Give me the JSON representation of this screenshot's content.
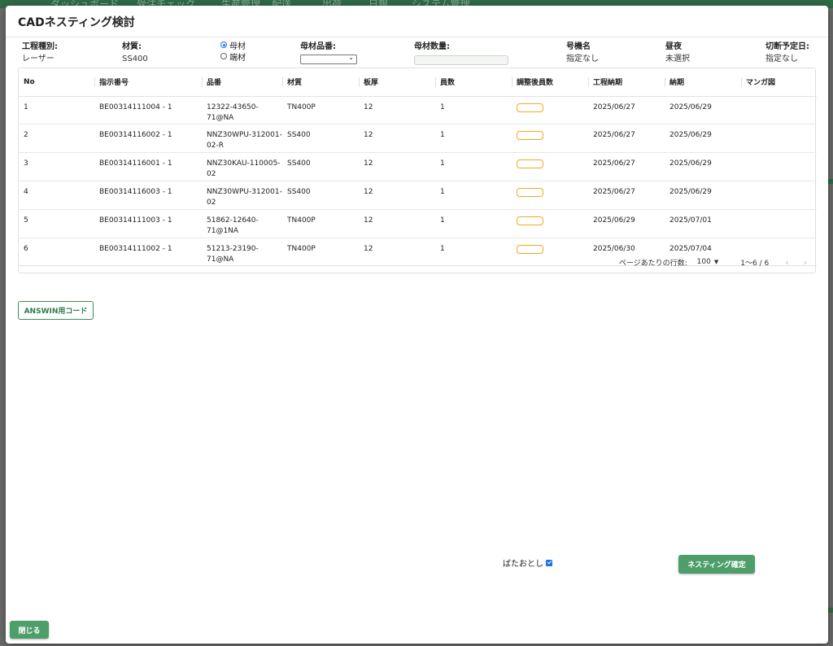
{
  "modal": {
    "title": "CADネスティング検討"
  },
  "header_fields": {
    "process_type": {
      "label": "工程種別:",
      "value": "レーザー"
    },
    "material": {
      "label": "材質:",
      "value": "SS400"
    },
    "source_options": [
      {
        "label": "母材",
        "checked": true
      },
      {
        "label": "端材",
        "checked": false
      }
    ],
    "base_material_part": {
      "label": "母材品番:",
      "selected": ""
    },
    "base_material_qty": {
      "label": "母材数量:",
      "value": ""
    },
    "machine_name": {
      "label": "号機名",
      "value": "指定なし"
    },
    "day_night": {
      "label": "昼夜",
      "value": "未選択"
    },
    "cut_date": {
      "label": "切断予定日:",
      "value": "指定なし"
    }
  },
  "table": {
    "columns": [
      "No",
      "指示番号",
      "品番",
      "材質",
      "板厚",
      "員数",
      "調整後員数",
      "工程納期",
      "納期",
      "マンガ図"
    ],
    "rows": [
      {
        "no": "1",
        "instr": "BE00314111004 - 1",
        "part": "12322-43650-71@NA",
        "mat": "TN400P",
        "thick": "12",
        "qty": "1",
        "proc_due": "2025/06/27",
        "due": "2025/06/29",
        "manga": ""
      },
      {
        "no": "2",
        "instr": "BE00314116002 - 1",
        "part": "NNZ30WPU-312001-02-R",
        "mat": "SS400",
        "thick": "12",
        "qty": "1",
        "proc_due": "2025/06/27",
        "due": "2025/06/29",
        "manga": ""
      },
      {
        "no": "3",
        "instr": "BE00314116001 - 1",
        "part": "NNZ30KAU-110005-02",
        "mat": "SS400",
        "thick": "12",
        "qty": "1",
        "proc_due": "2025/06/27",
        "due": "2025/06/29",
        "manga": ""
      },
      {
        "no": "4",
        "instr": "BE00314116003 - 1",
        "part": "NNZ30WPU-312001-02",
        "mat": "SS400",
        "thick": "12",
        "qty": "1",
        "proc_due": "2025/06/27",
        "due": "2025/06/29",
        "manga": ""
      },
      {
        "no": "5",
        "instr": "BE00314111003 - 1",
        "part": "51862-12640-71@1NA",
        "mat": "TN400P",
        "thick": "12",
        "qty": "1",
        "proc_due": "2025/06/29",
        "due": "2025/07/01",
        "manga": ""
      },
      {
        "no": "6",
        "instr": "BE00314111002 - 1",
        "part": "51213-23190-71@NA",
        "mat": "TN400P",
        "thick": "12",
        "qty": "1",
        "proc_due": "2025/06/30",
        "due": "2025/07/04",
        "manga": ""
      }
    ]
  },
  "pagination": {
    "rows_per_page_label": "ページあたりの行数:",
    "rows_per_page": "100",
    "range": "1〜6 / 6"
  },
  "buttons": {
    "answin": "ANSWIN用コード",
    "confirm": "ネスティング確定",
    "close": "閉じる"
  },
  "drop_option": {
    "label": "ばたおとし",
    "checked": true
  },
  "colors": {
    "accent_green": "#4e9e6b",
    "outline_green": "#3f8d5b",
    "adjust_border": "#f5a623",
    "checkbox_blue": "#1a73e8"
  }
}
